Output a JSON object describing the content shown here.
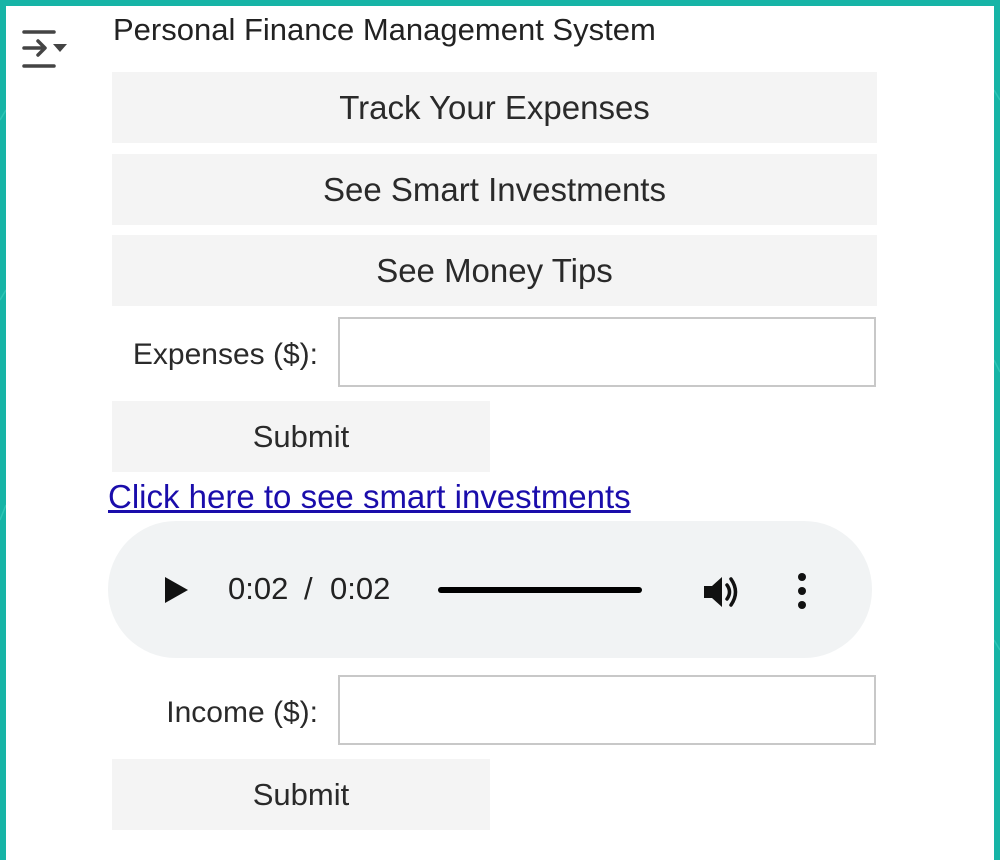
{
  "app": {
    "title": "Personal Finance Management System"
  },
  "icons": {
    "menu": "filter-menu-icon",
    "play": "play-icon",
    "volume": "volume-icon",
    "more": "more-vertical-icon"
  },
  "nav": {
    "track_expenses": "Track Your Expenses",
    "smart_investments": "See Smart Investments",
    "money_tips": "See Money Tips"
  },
  "expenses_form": {
    "label": "Expenses ($):",
    "value": "",
    "submit_label": "Submit"
  },
  "investment_link": {
    "text": "Click here to see smart investments"
  },
  "audio": {
    "current_time": "0:02",
    "separator": "/",
    "duration": "0:02",
    "progress": 1.0
  },
  "income_form": {
    "label": "Income ($):",
    "value": "",
    "submit_label": "Submit"
  },
  "colors": {
    "frame_background": "#16b4a6",
    "link": "#1a0dab",
    "button_background": "#f4f4f4",
    "player_background": "#f1f3f4"
  }
}
